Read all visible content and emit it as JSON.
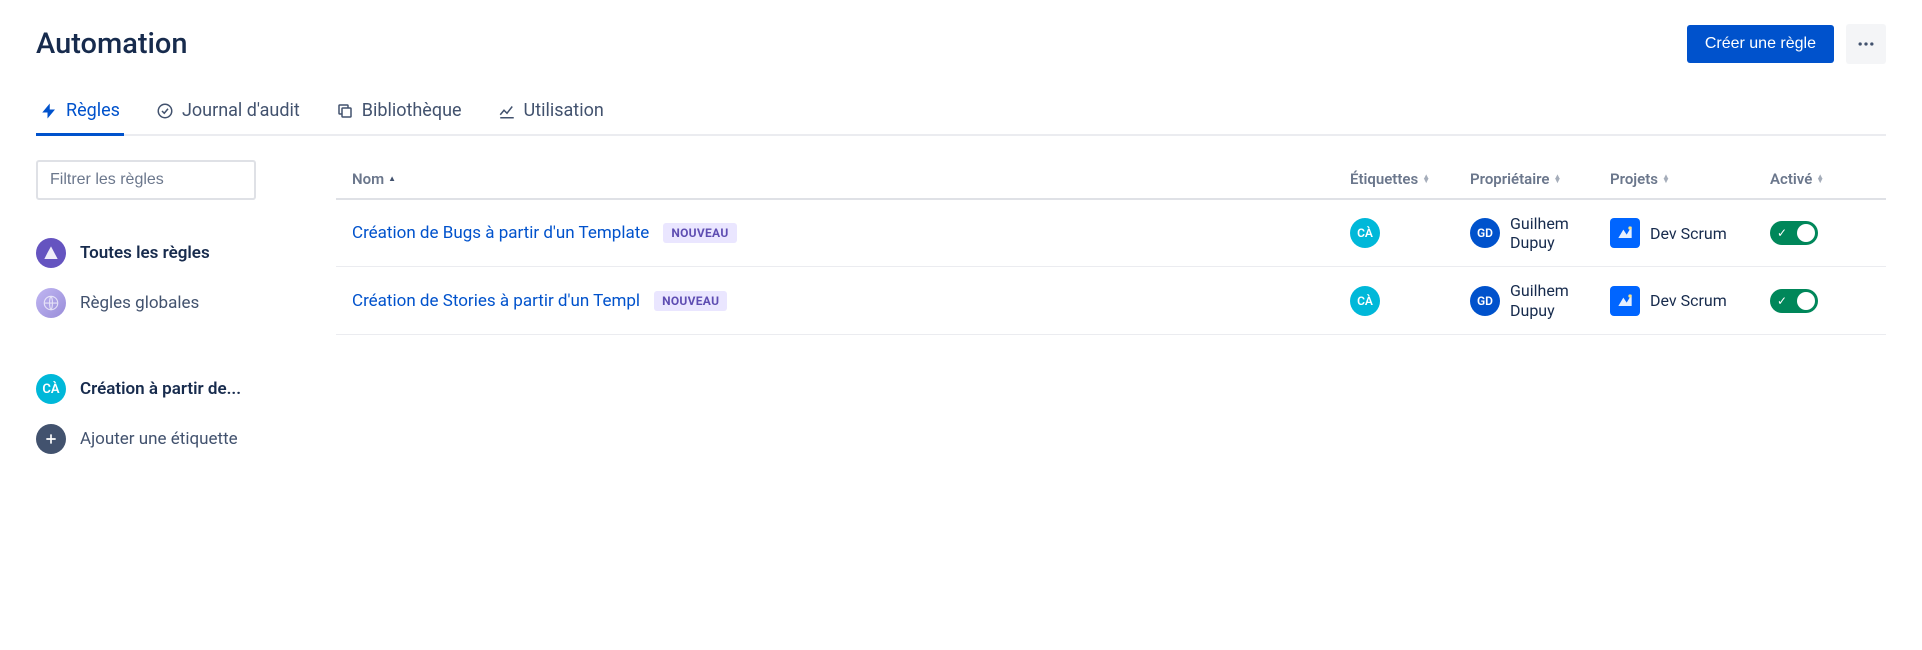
{
  "page": {
    "title": "Automation",
    "create_button": "Créer une règle"
  },
  "tabs": [
    {
      "label": "Règles",
      "icon": "bolt"
    },
    {
      "label": "Journal d'audit",
      "icon": "check-circle"
    },
    {
      "label": "Bibliothèque",
      "icon": "copy"
    },
    {
      "label": "Utilisation",
      "icon": "chart"
    }
  ],
  "sidebar": {
    "filter_placeholder": "Filtrer les règles",
    "items": [
      {
        "label": "Toutes les règles",
        "avatar": "A",
        "avatarClass": "av-purple",
        "bold": true
      },
      {
        "label": "Règles globales",
        "avatar": "",
        "avatarClass": "av-globe",
        "bold": false
      },
      {
        "label": "Création à partir de...",
        "avatar": "CÀ",
        "avatarClass": "av-teal",
        "bold": true,
        "gap": true
      },
      {
        "label": "Ajouter une étiquette",
        "avatar": "+",
        "avatarClass": "av-gray",
        "bold": false
      }
    ]
  },
  "table": {
    "columns": {
      "name": "Nom",
      "tags": "Étiquettes",
      "owner": "Propriétaire",
      "projects": "Projets",
      "enabled": "Activé"
    },
    "rows": [
      {
        "name": "Création de Bugs à partir d'un Template",
        "badge": "NOUVEAU",
        "tag_initials": "CÀ",
        "owner_initials": "GD",
        "owner_name": "Guilhem Dupuy",
        "project_name": "Dev Scrum",
        "enabled": true
      },
      {
        "name": "Création de Stories à partir d'un Templ",
        "badge": "NOUVEAU",
        "tag_initials": "CÀ",
        "owner_initials": "GD",
        "owner_name": "Guilhem Dupuy",
        "project_name": "Dev Scrum",
        "enabled": true
      }
    ]
  }
}
